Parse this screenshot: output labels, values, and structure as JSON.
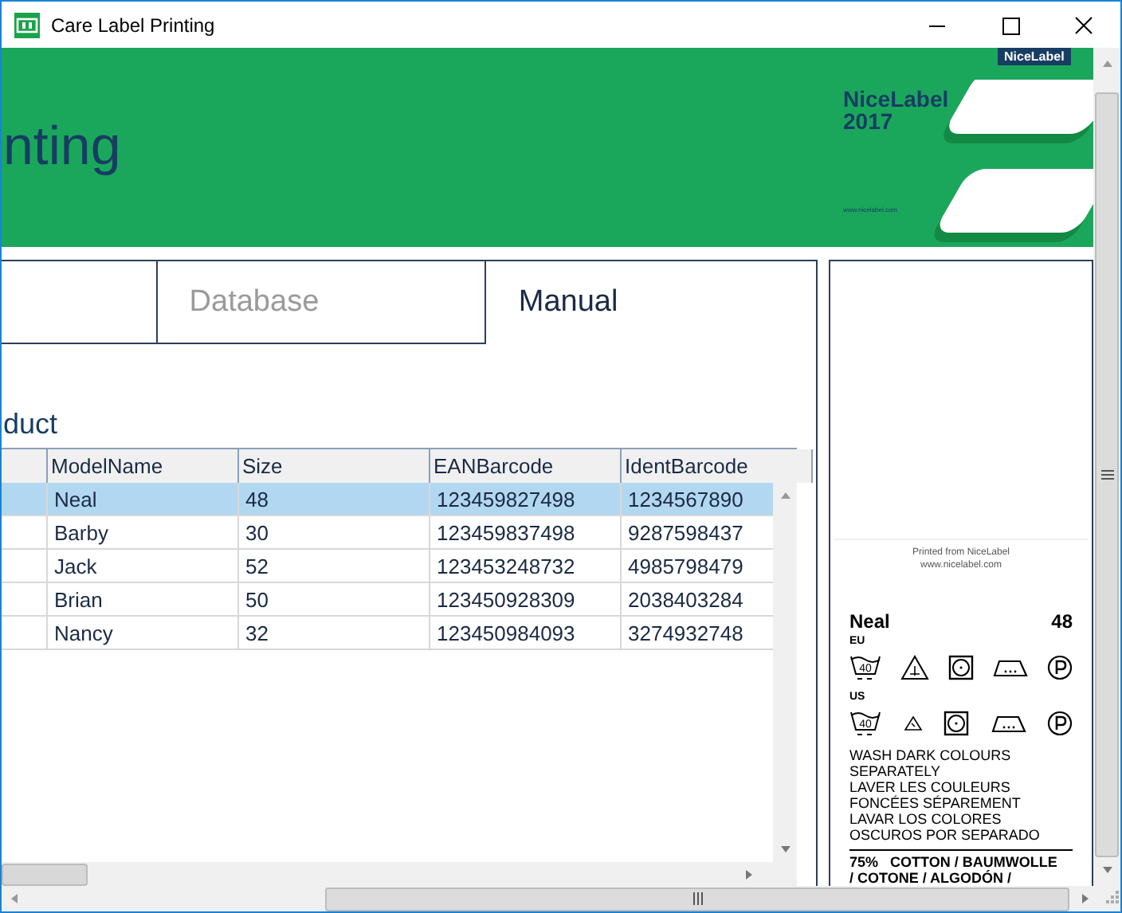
{
  "window": {
    "title": "Care Label Printing"
  },
  "banner": {
    "heading": "nting",
    "logo_badge": "NiceLabel",
    "product": "NiceLabel",
    "year": "2017",
    "url": "www.nicelabel.com"
  },
  "tabs": [
    {
      "label": "Database",
      "selected": false
    },
    {
      "label": "Manual",
      "selected": true
    }
  ],
  "grid": {
    "heading": "duct",
    "columns": [
      "ModelName",
      "Size",
      "EANBarcode",
      "IdentBarcode"
    ],
    "rows": [
      {
        "cells": [
          "Neal",
          "48",
          "123459827498",
          "1234567890"
        ],
        "selected": true
      },
      {
        "cells": [
          "Barby",
          "30",
          "123459837498",
          "9287598437"
        ],
        "selected": false
      },
      {
        "cells": [
          "Jack",
          "52",
          "123453248732",
          "4985798479"
        ],
        "selected": false
      },
      {
        "cells": [
          "Brian",
          "50",
          "123450928309",
          "2038403284"
        ],
        "selected": false
      },
      {
        "cells": [
          "Nancy",
          "32",
          "123450984093",
          "3274932748"
        ],
        "selected": false
      }
    ]
  },
  "label_preview": {
    "printed_from": "Printed from NiceLabel",
    "url": "www.nicelabel.com",
    "model": "Neal",
    "size": "48",
    "regions": [
      {
        "name": "EU",
        "wash_temp": "40"
      },
      {
        "name": "US",
        "wash_temp": "40"
      }
    ],
    "care_text": "WASH DARK COLOURS\nSEPARATELY\nLAVER LES COULEURS\nFONCÉES SÉPAREMENT\nLAVAR LOS COLORES\nOSCUROS POR SEPARADO",
    "composition": "75%   COTTON / BAUMWOLLE",
    "composition_more": "/ COTONE / ALGODÓN /"
  }
}
